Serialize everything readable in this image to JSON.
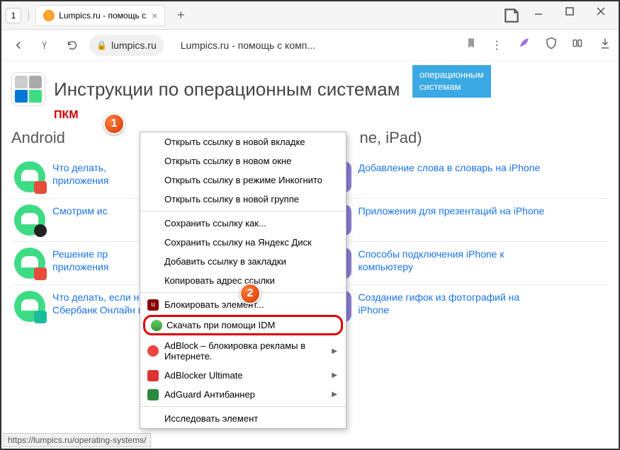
{
  "titlebar": {
    "tab_counter": "1",
    "tab_title": "Lumpics.ru - помощь с"
  },
  "addressbar": {
    "domain": "lumpics.ru",
    "page_title": "Lumpics.ru - помощь с комп..."
  },
  "tooltip": {
    "line1": "операционным",
    "line2": "системам"
  },
  "page": {
    "heading": "Инструкции по операционным системам",
    "pkm": "ПКМ",
    "col_left_title": "Android",
    "col_right_title_suffix": "ne, iPad)",
    "left_articles": [
      "Что делать,",
      "приложения",
      "Смотрим ис",
      "Решение пр",
      "приложения",
      "Что делать, если не обновляется",
      "Сбербанк Онлайн в Android"
    ],
    "right_articles": [
      "Добавление слова в словарь на iPhone",
      "Приложения для презентаций на iPhone",
      "Способы подключения iPhone к",
      "компьютеру",
      "Создание гифок из фотографий на",
      "iPhone"
    ]
  },
  "context_menu": {
    "items": [
      "Открыть ссылку в новой вкладке",
      "Открыть ссылку в новом окне",
      "Открыть ссылку в режиме Инкогнито",
      "Открыть ссылку в новой группе"
    ],
    "items2": [
      "Сохранить ссылку как...",
      "Сохранить ссылку на Яндекс Диск",
      "Добавить ссылку в закладки",
      "Копировать адрес ссылки"
    ],
    "block_element": "Блокировать элемент...",
    "idm": "Скачать при помощи IDM",
    "adblock": "AdBlock – блокировка рекламы в Интернете.",
    "adblocker_ultimate": "AdBlocker Ultimate",
    "adguard": "AdGuard Антибаннер",
    "inspect": "Исследовать элемент"
  },
  "callouts": {
    "one": "1",
    "two": "2"
  },
  "statusbar": {
    "url": "https://lumpics.ru/operating-systems/"
  }
}
